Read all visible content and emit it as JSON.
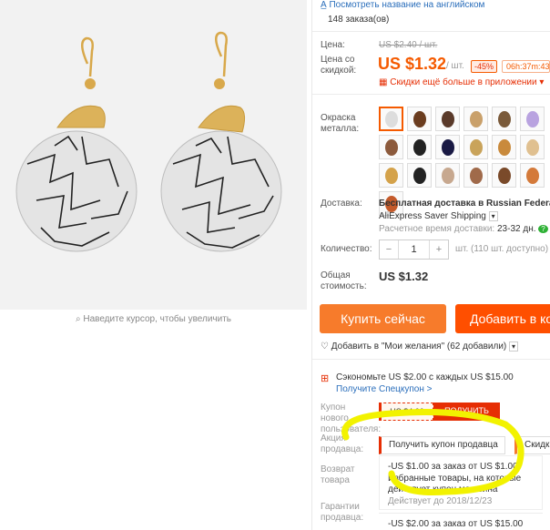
{
  "header": {
    "translate_link": "Посмотреть название на английском",
    "orders": "148 заказа(ов)"
  },
  "price": {
    "label": "Цена:",
    "old_price": "US $2.40 / шт.",
    "discount_label": "Цена со скидкой:",
    "new_price": "US $1.32",
    "unit": "/ шт.",
    "discount_badge": "-45%",
    "timer": "06h:37m:43",
    "app_discount": "Скидки ещё больше в приложении"
  },
  "color": {
    "label": "Окраска металла:",
    "options_count": 19
  },
  "delivery": {
    "label": "Доставка:",
    "text": "Бесплатная доставка в Russian Federation",
    "method": "AliExpress Saver Shipping",
    "eta_label": "Расчетное время доставки:",
    "eta_value": "23-32 дн."
  },
  "quantity": {
    "label": "Количество:",
    "value": "1",
    "minus": "−",
    "plus": "+",
    "available": "шт. (110 шт. доступно)"
  },
  "total": {
    "label": "Общая стоимость:",
    "value": "US $1.32"
  },
  "actions": {
    "buy_now": "Купить сейчас",
    "add_to_cart": "Добавить в корзину",
    "wishlist": "Добавить в \"Мои желания\" (62 добавили)"
  },
  "promo": {
    "save_text": "Сэкономьте US $2.00 с каждых US $15.00",
    "special_coupon": "Получите Спецкупон >",
    "new_user_label": "Купон нового пользователя:",
    "new_user_value": "US $4.00",
    "get_button": "ПОЛУЧИТЬ",
    "seller_label": "Акция продавца:",
    "seller_dropdown": "Получить купон продавца",
    "seller_dropdown2": "Скидка",
    "coupon1_title": "-US $1.00 за заказ от US $1.00",
    "coupon1_desc": "Избранные товары, на которые действует купон магазина",
    "coupon1_valid": "Действует до 2018/12/23",
    "coupon2_title": "-US $2.00 за заказ от US $15.00",
    "return_label": "Возврат товара",
    "guarantee_label": "Гарантии продавца:"
  },
  "zoom_hint": "Наведите курсор, чтобы увеличить",
  "colors": {
    "accent": "#f55a00",
    "link": "#2a6ebb",
    "red": "#e62e04",
    "highlight": "#f2f200"
  }
}
